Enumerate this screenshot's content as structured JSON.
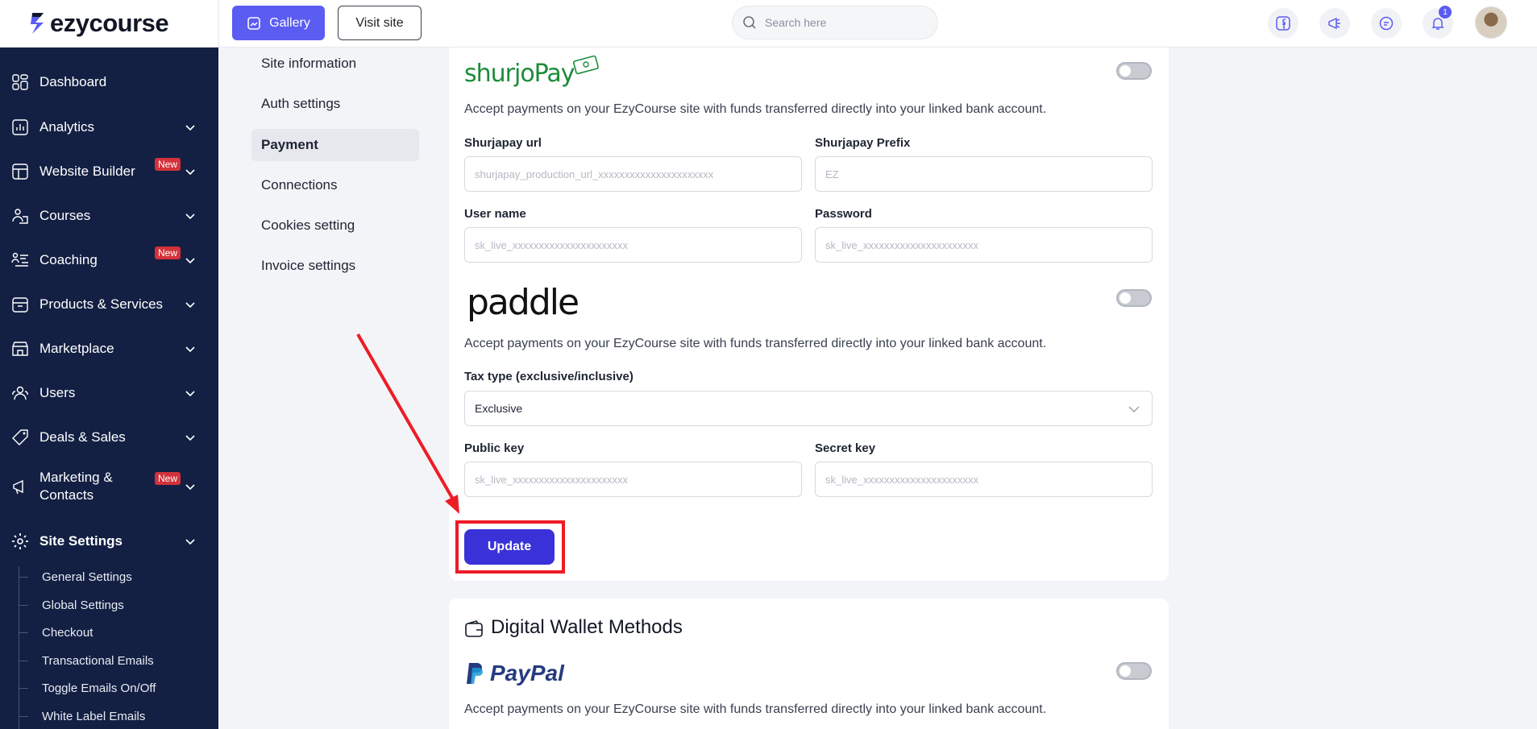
{
  "brand": {
    "name": "ezycourse"
  },
  "topbar": {
    "gallery_label": "Gallery",
    "visit_label": "Visit site",
    "search_placeholder": "Search here",
    "notification_count": "1"
  },
  "sidebar": {
    "items": [
      {
        "label": "Dashboard",
        "icon": "dashboard-icon"
      },
      {
        "label": "Analytics",
        "icon": "analytics-icon"
      },
      {
        "label": "Website Builder",
        "icon": "website-builder-icon",
        "badge": "New"
      },
      {
        "label": "Courses",
        "icon": "courses-icon"
      },
      {
        "label": "Coaching",
        "icon": "coaching-icon",
        "badge": "New"
      },
      {
        "label": "Products & Services",
        "icon": "products-icon"
      },
      {
        "label": "Marketplace",
        "icon": "marketplace-icon"
      },
      {
        "label": "Users",
        "icon": "users-icon"
      },
      {
        "label": "Deals & Sales",
        "icon": "deals-icon"
      },
      {
        "label": "Marketing &",
        "label2": "Contacts",
        "icon": "marketing-icon",
        "badge": "New"
      },
      {
        "label": "Site Settings",
        "icon": "site-settings-icon"
      }
    ],
    "sub_items": [
      "General Settings",
      "Global Settings",
      "Checkout",
      "Transactional Emails",
      "Toggle Emails On/Off",
      "White Label Emails"
    ]
  },
  "settings_nav": {
    "items": [
      "Site information",
      "Auth settings",
      "Payment",
      "Connections",
      "Cookies setting",
      "Invoice settings"
    ],
    "active": "Payment"
  },
  "shurjopay": {
    "logo_text": "shurjoPay",
    "description": "Accept payments on your EzyCourse site with funds transferred directly into your linked bank account.",
    "url_label": "Shurjapay url",
    "url_placeholder": "shurjapay_production_url_xxxxxxxxxxxxxxxxxxxxxx",
    "prefix_label": "Shurjapay Prefix",
    "prefix_placeholder": "EZ",
    "username_label": "User name",
    "username_placeholder": "sk_live_xxxxxxxxxxxxxxxxxxxxxx",
    "password_label": "Password",
    "password_placeholder": "sk_live_xxxxxxxxxxxxxxxxxxxxxx",
    "enabled": false
  },
  "paddle": {
    "logo_text": "paddle",
    "description": "Accept payments on your EzyCourse site with funds transferred directly into your linked bank account.",
    "tax_label": "Tax type (exclusive/inclusive)",
    "tax_value": "Exclusive",
    "public_key_label": "Public key",
    "public_key_placeholder": "sk_live_xxxxxxxxxxxxxxxxxxxxxx",
    "secret_key_label": "Secret key",
    "secret_key_placeholder": "sk_live_xxxxxxxxxxxxxxxxxxxxxx",
    "enabled": false
  },
  "update_label": "Update",
  "wallet": {
    "title": "Digital Wallet Methods",
    "paypal_logo": "PayPal",
    "description": "Accept payments on your EzyCourse site with funds transferred directly into your linked bank account.",
    "enabled": false
  },
  "colors": {
    "sidebar_bg": "#132043",
    "accent": "#5b5cf2",
    "update_button": "#3a32d8",
    "highlight": "#ee1c25"
  }
}
